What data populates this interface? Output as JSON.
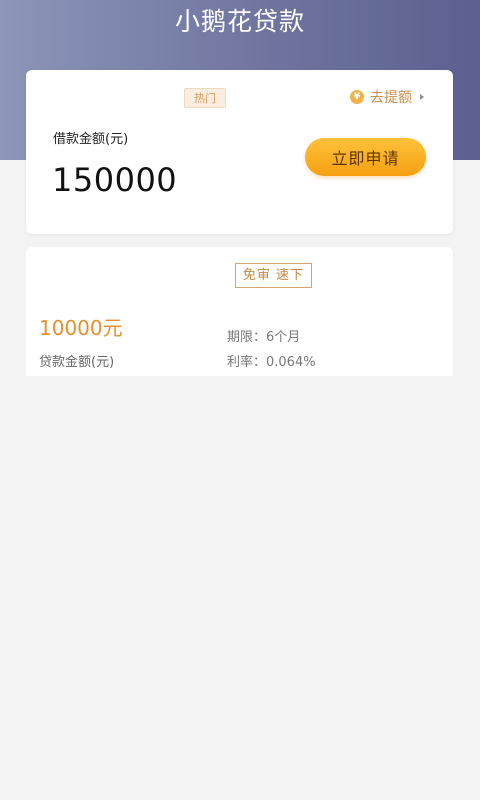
{
  "app": {
    "title": "小鹅花贷款"
  },
  "main_card": {
    "hot_tag": "热门",
    "quota_link": "去提额",
    "coin_glyph": "¥",
    "amount_label": "借款金额(元)",
    "amount": "150000",
    "apply_button": "立即申请"
  },
  "product_card": {
    "feature_tag": "免审 速下",
    "amount": "10000元",
    "amount_label": "贷款金额(元)",
    "term": "期限：6个月",
    "rate": "利率：0.064%"
  },
  "colors": {
    "header_gradient_start": "#8d95b8",
    "header_gradient_end": "#5b6090",
    "accent_orange": "#f5a011",
    "amount_orange": "#e4912e",
    "page_background": "#f3f3f3"
  },
  "icons": {
    "coin": "coin-icon",
    "caret": "caret-right-icon"
  }
}
